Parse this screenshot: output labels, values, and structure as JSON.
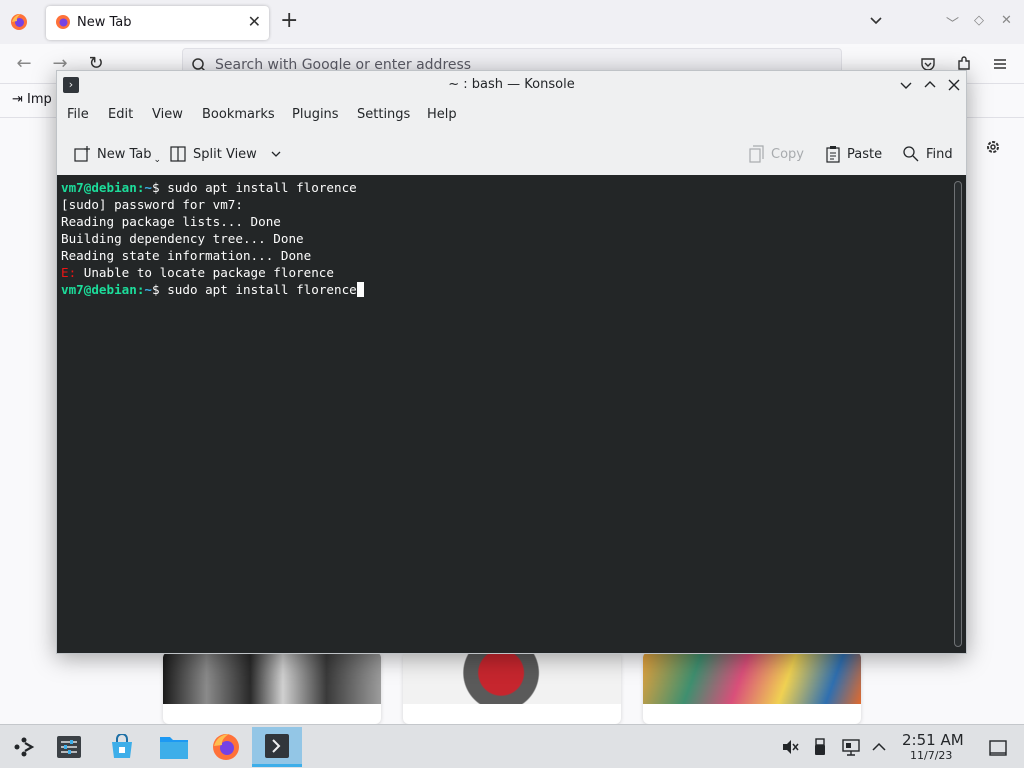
{
  "firefox": {
    "tab_title": "New Tab",
    "url_placeholder": "Search with Google or enter address",
    "import_label": "Imp",
    "accent": "#0061e0"
  },
  "konsole": {
    "window_title": "~ : bash — Konsole",
    "menu": [
      "File",
      "Edit",
      "View",
      "Bookmarks",
      "Plugins",
      "Settings",
      "Help"
    ],
    "toolbar": {
      "new_tab": "New Tab",
      "split_view": "Split View",
      "copy": "Copy",
      "paste": "Paste",
      "find": "Find"
    },
    "terminal": {
      "user_host": "vm7@debian",
      "path": "~",
      "prompt_symbol": "$",
      "command1": " sudo apt install florence",
      "line_password": "[sudo] password for vm7:",
      "line_reading": "Reading package lists... Done",
      "line_building": "Building dependency tree... Done",
      "line_state": "Reading state information... Done",
      "error_prefix": "E:",
      "error_message": " Unable to locate package florence",
      "command2": " sudo apt install florence"
    },
    "colors": {
      "background": "#232627",
      "prompt_user": "#1cdc9a",
      "prompt_path": "#3daee9",
      "error": "#ed1515"
    }
  },
  "taskbar": {
    "time": "2:51 AM",
    "date": "11/7/23",
    "apps": [
      "application-launcher-icon",
      "system-settings-icon",
      "discover-store-icon",
      "dolphin-files-icon",
      "firefox-icon",
      "konsole-icon"
    ],
    "tray": [
      "volume-muted-icon",
      "usb-device-icon",
      "network-wired-icon",
      "show-hidden-icons-chevron"
    ]
  }
}
